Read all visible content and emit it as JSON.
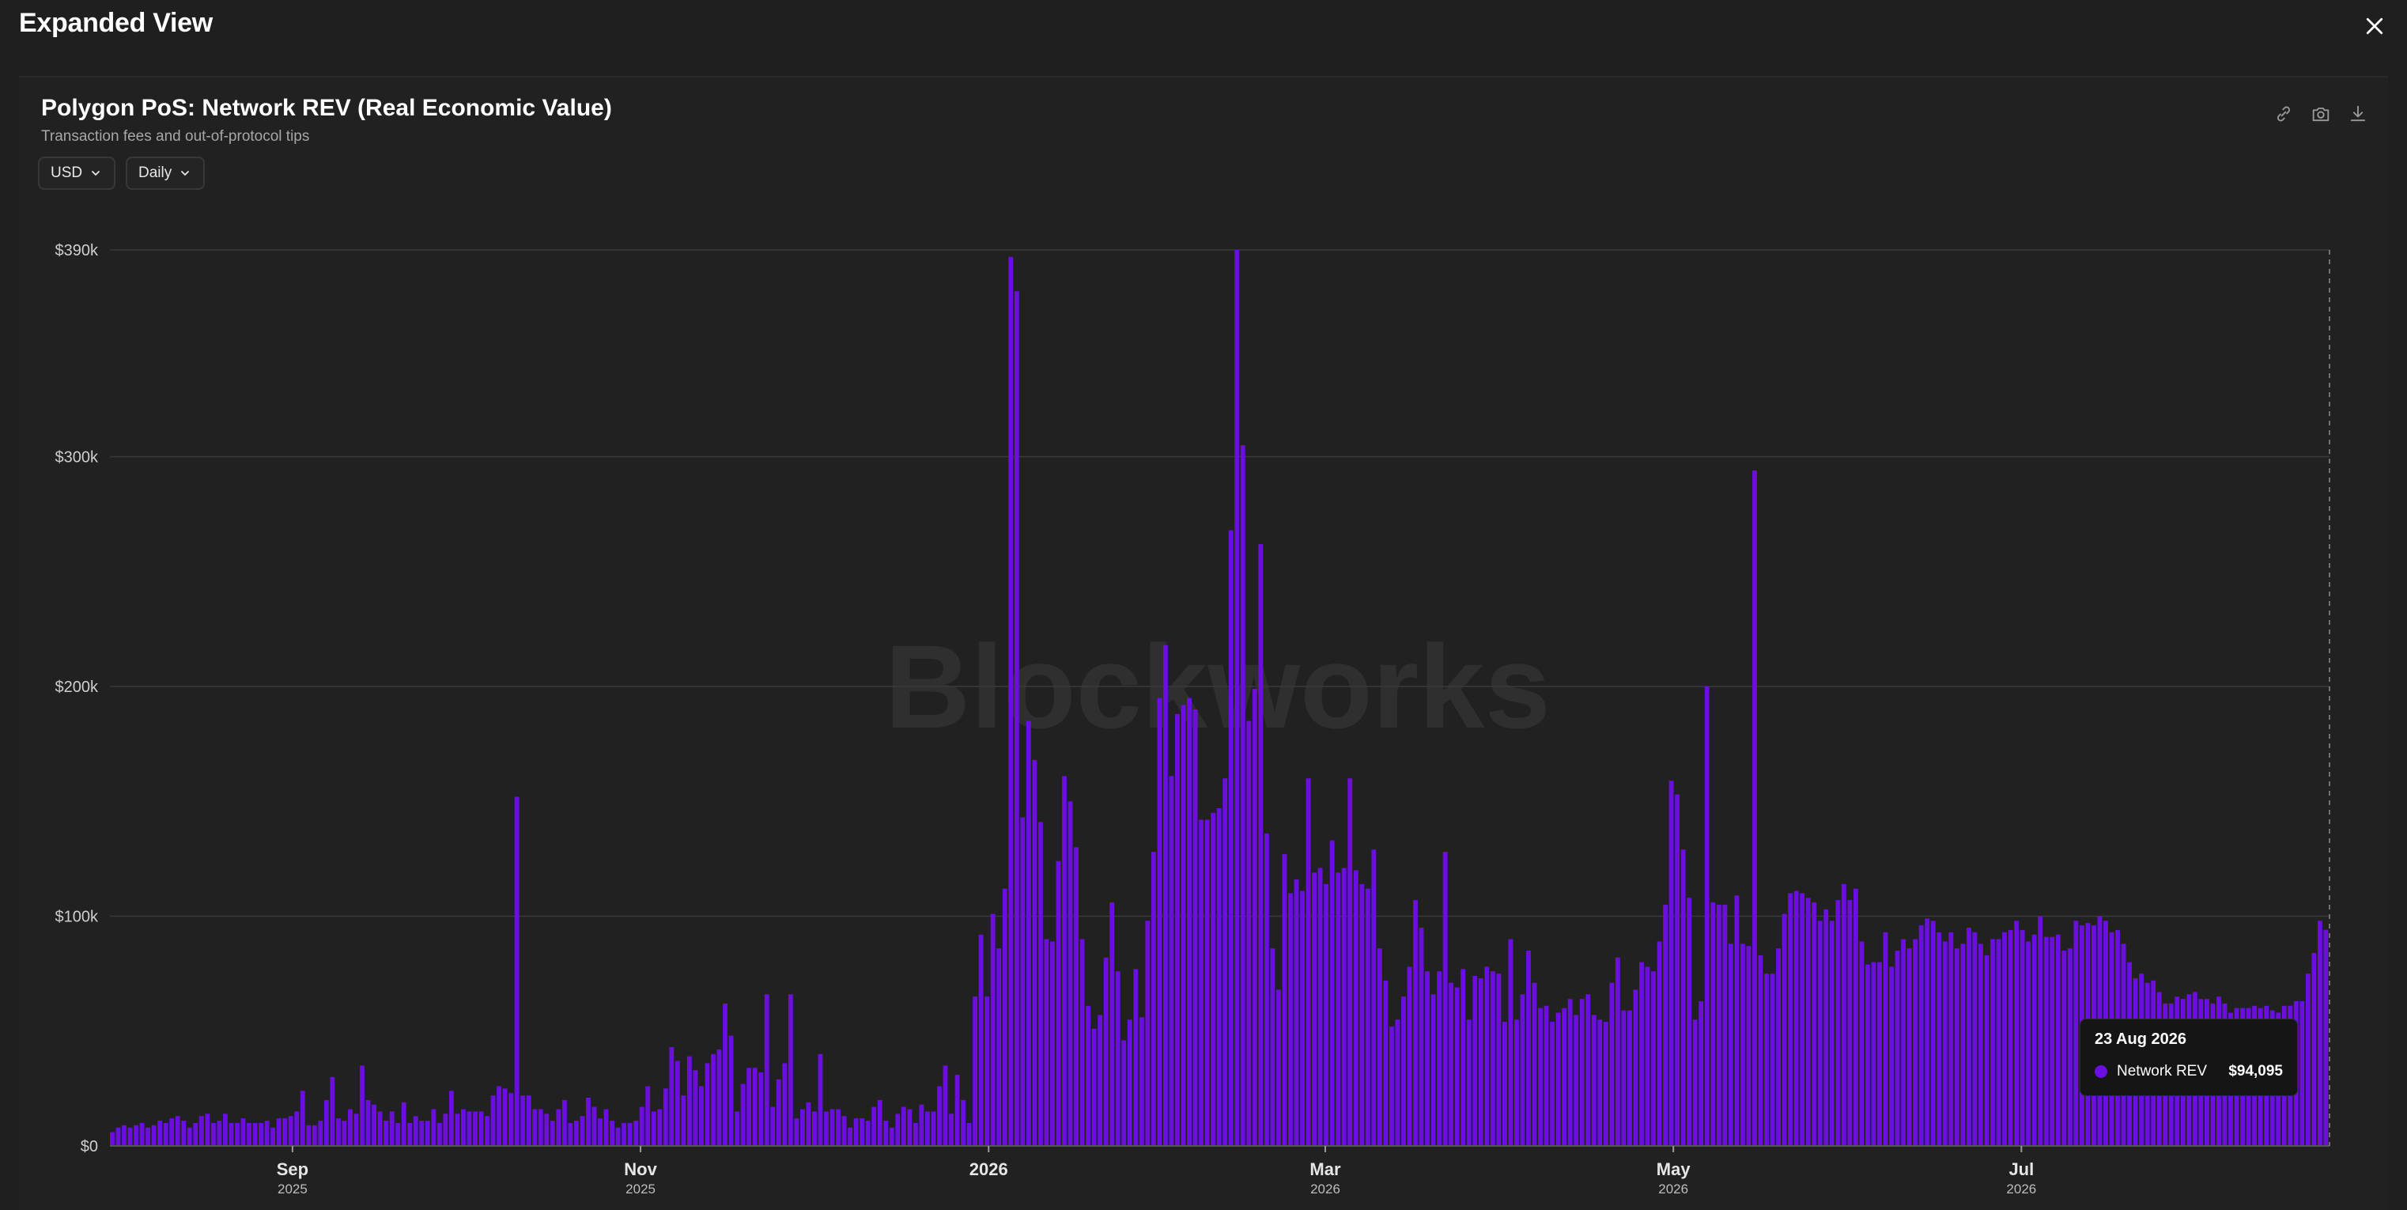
{
  "window": {
    "title": "Expanded View",
    "close_icon": "close-icon"
  },
  "chart_card": {
    "title": "Polygon PoS: Network REV (Real Economic Value)",
    "subtitle": "Transaction fees and out-of-protocol tips",
    "currency_dropdown": {
      "label": "USD",
      "icon": "chevron-down-icon"
    },
    "interval_dropdown": {
      "label": "Daily",
      "icon": "chevron-down-icon"
    },
    "toolbar": [
      "link-icon",
      "camera-icon",
      "download-icon"
    ],
    "watermark": "Blockworks"
  },
  "tooltip": {
    "date": "23 Aug 2026",
    "series": "Network REV",
    "value": "$94,095"
  },
  "colors": {
    "bar": "#6b0ee0",
    "background": "#1f1f1f",
    "grid": "#3a3a3a"
  },
  "chart_data": {
    "type": "bar",
    "series": [
      {
        "name": "Network REV"
      }
    ],
    "x_start": "2025-07-31",
    "x_end": "2026-08-23",
    "ylim": [
      0,
      390000
    ],
    "y_ticks": [
      {
        "value": 0,
        "label": "$0"
      },
      {
        "value": 100000,
        "label": "$100k"
      },
      {
        "value": 200000,
        "label": "$200k"
      },
      {
        "value": 300000,
        "label": "$300k"
      },
      {
        "value": 390000,
        "label": "$390k"
      }
    ],
    "x_ticks": [
      {
        "date": "2025-09-01",
        "label": "Sep",
        "sub": "2025"
      },
      {
        "date": "2025-11-01",
        "label": "Nov",
        "sub": "2025"
      },
      {
        "date": "2026-01-01",
        "label": "2026",
        "sub": ""
      },
      {
        "date": "2026-03-01",
        "label": "Mar",
        "sub": "2026"
      },
      {
        "date": "2026-05-01",
        "label": "May",
        "sub": "2026"
      },
      {
        "date": "2026-07-01",
        "label": "Jul",
        "sub": "2026"
      }
    ],
    "values": [
      6000,
      8000,
      9000,
      8000,
      9000,
      10000,
      8000,
      9000,
      11000,
      10000,
      12000,
      13000,
      11000,
      8000,
      10000,
      13000,
      14000,
      10000,
      11000,
      14000,
      10000,
      10000,
      12000,
      10000,
      10000,
      10000,
      11000,
      8000,
      12000,
      12000,
      13000,
      15000,
      24000,
      9000,
      9000,
      11000,
      20000,
      30000,
      12000,
      11000,
      16000,
      14000,
      35000,
      20000,
      18000,
      15000,
      11000,
      15000,
      10000,
      19000,
      10000,
      13000,
      11000,
      11000,
      16000,
      10000,
      14000,
      24000,
      14000,
      16000,
      15000,
      15000,
      15000,
      13000,
      22000,
      26000,
      25000,
      23000,
      152000,
      22000,
      22000,
      16000,
      16000,
      14000,
      11000,
      16000,
      20000,
      10000,
      11000,
      13000,
      21000,
      17000,
      12000,
      16000,
      11000,
      8000,
      10000,
      10000,
      11000,
      17000,
      26000,
      15000,
      16000,
      25000,
      43000,
      37000,
      22000,
      39000,
      33000,
      26000,
      36000,
      40000,
      42000,
      62000,
      48000,
      15000,
      27000,
      34000,
      34000,
      32000,
      66000,
      17000,
      29000,
      36000,
      66000,
      12000,
      16000,
      19000,
      15000,
      40000,
      15000,
      16000,
      16000,
      13000,
      8000,
      12000,
      12000,
      11000,
      17000,
      20000,
      11000,
      8000,
      14000,
      17000,
      16000,
      10000,
      18000,
      15000,
      15000,
      26000,
      35000,
      14000,
      31000,
      20000,
      10000,
      65000,
      92000,
      65000,
      101000,
      86000,
      112000,
      387000,
      372000,
      143000,
      185000,
      168000,
      141000,
      90000,
      89000,
      124000,
      161000,
      150000,
      130000,
      90000,
      61000,
      51000,
      57000,
      82000,
      106000,
      76000,
      46000,
      55000,
      77000,
      56000,
      98000,
      128000,
      195000,
      218000,
      161000,
      188000,
      192000,
      195000,
      190000,
      142000,
      142000,
      145000,
      147000,
      160000,
      268000,
      390000,
      305000,
      185000,
      199000,
      262000,
      136000,
      86000,
      68000,
      127000,
      110000,
      116000,
      111000,
      160000,
      119000,
      121000,
      114000,
      133000,
      119000,
      121000,
      160000,
      120000,
      114000,
      112000,
      129000,
      86000,
      72000,
      52000,
      55000,
      65000,
      78000,
      107000,
      95000,
      76000,
      66000,
      76000,
      128000,
      71000,
      69000,
      77000,
      55000,
      74000,
      73000,
      78000,
      76000,
      75000,
      54000,
      90000,
      55000,
      66000,
      85000,
      71000,
      60000,
      61000,
      54000,
      58000,
      60000,
      64000,
      57000,
      64000,
      66000,
      57000,
      55000,
      54000,
      71000,
      82000,
      59000,
      59000,
      68000,
      80000,
      78000,
      76000,
      89000,
      105000,
      159000,
      153000,
      129000,
      108000,
      55000,
      63000,
      200000,
      106000,
      105000,
      105000,
      88000,
      109000,
      88000,
      87000,
      294000,
      83000,
      75000,
      75000,
      86000,
      101000,
      110000,
      111000,
      110000,
      108000,
      106000,
      98000,
      103000,
      98000,
      107000,
      114000,
      107000,
      112000,
      89000,
      79000,
      80000,
      80000,
      93000,
      78000,
      85000,
      90000,
      86000,
      90000,
      96000,
      99000,
      98000,
      93000,
      89000,
      93000,
      86000,
      88000,
      95000,
      93000,
      88000,
      83000,
      90000,
      90000,
      93000,
      94000,
      98000,
      94000,
      89000,
      92000,
      100000,
      91000,
      91000,
      92000,
      85000,
      86000,
      98000,
      96000,
      97000,
      96000,
      100000,
      98000,
      93000,
      94000,
      88000,
      80000,
      73000,
      75000,
      71000,
      72000,
      67000,
      62000,
      62000,
      65000,
      64000,
      66000,
      67000,
      64000,
      64000,
      62000,
      65000,
      62000,
      58000,
      60000,
      60000,
      60000,
      61000,
      60000,
      61000,
      59000,
      58000,
      61000,
      61000,
      63000,
      63000,
      75000,
      84000,
      98000,
      94095
    ]
  }
}
